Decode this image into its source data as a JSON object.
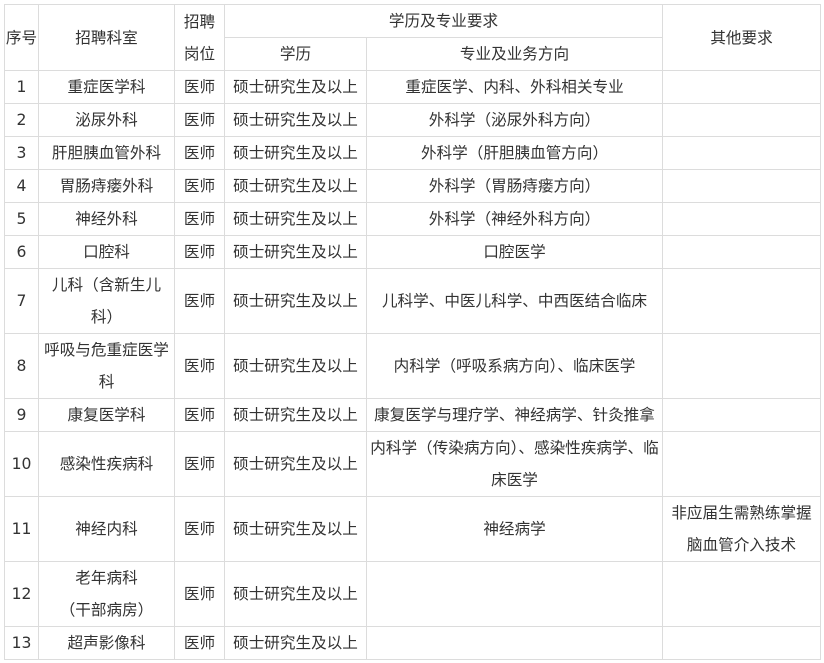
{
  "table": {
    "header": {
      "index": "序号",
      "department": "招聘科室",
      "position": "招聘岗位",
      "education_group": "学历及专业要求",
      "education": "学历",
      "major": "专业及业务方向",
      "other": "其他要求"
    },
    "rows": [
      {
        "index": "1",
        "department": "重症医学科",
        "position": "医师",
        "education": "硕士研究生及以上",
        "major": "重症医学、内科、外科相关专业"
      },
      {
        "index": "2",
        "department": "泌尿外科",
        "position": "医师",
        "education": "硕士研究生及以上",
        "major": "外科学（泌尿外科方向）"
      },
      {
        "index": "3",
        "department": "肝胆胰血管外科",
        "position": "医师",
        "education": "硕士研究生及以上",
        "major": "外科学（肝胆胰血管方向）"
      },
      {
        "index": "4",
        "department": "胃肠痔瘘外科",
        "position": "医师",
        "education": "硕士研究生及以上",
        "major": "外科学（胃肠痔瘘方向）"
      },
      {
        "index": "5",
        "department": "神经外科",
        "position": "医师",
        "education": "硕士研究生及以上",
        "major": "外科学（神经外科方向）"
      },
      {
        "index": "6",
        "department": "口腔科",
        "position": "医师",
        "education": "硕士研究生及以上",
        "major": "口腔医学"
      },
      {
        "index": "7",
        "department": "儿科（含新生儿科）",
        "position": "医师",
        "education": "硕士研究生及以上",
        "major": "儿科学、中医儿科学、中西医结合临床"
      },
      {
        "index": "8",
        "department": "呼吸与危重症医学科",
        "position": "医师",
        "education": "硕士研究生及以上",
        "major": "内科学（呼吸系病方向）、临床医学"
      },
      {
        "index": "9",
        "department": "康复医学科",
        "position": "医师",
        "education": "硕士研究生及以上",
        "major": "康复医学与理疗学、神经病学、针灸推拿"
      },
      {
        "index": "10",
        "department": "感染性疾病科",
        "position": "医师",
        "education": "硕士研究生及以上",
        "major": "内科学（传染病方向）、感染性疾病学、临床医学"
      },
      {
        "index": "11",
        "department": "神经内科",
        "position": "医师",
        "education": "硕士研究生及以上",
        "major": "神经病学",
        "other": "非应届生需熟练掌握脑血管介入技术"
      },
      {
        "index": "12",
        "department": "老年病科\n（干部病房）",
        "position": "医师",
        "education": "硕士研究生及以上"
      },
      {
        "index": "13",
        "department": "超声影像科",
        "position": "医师",
        "education": "硕士研究生及以上"
      }
    ]
  }
}
